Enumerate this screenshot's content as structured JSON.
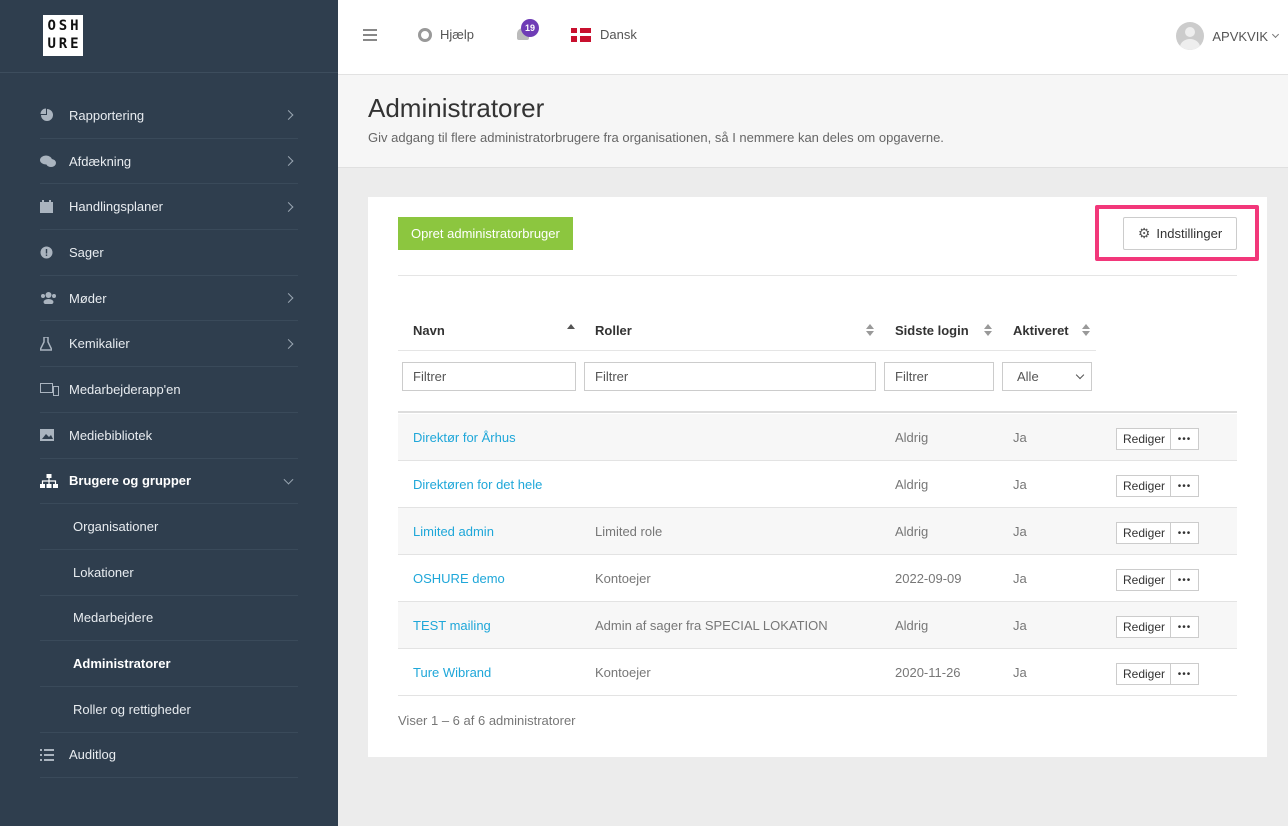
{
  "logo": {
    "letters": [
      "O",
      "S",
      "H",
      "U",
      "R",
      "E"
    ]
  },
  "sidebar": {
    "items": [
      {
        "label": "Rapportering",
        "icon": "pie-chart-icon"
      },
      {
        "label": "Afdækning",
        "icon": "chat-bubbles-icon"
      },
      {
        "label": "Handlingsplaner",
        "icon": "calendar-icon"
      },
      {
        "label": "Sager",
        "icon": "exclamation-circle-icon"
      },
      {
        "label": "Møder",
        "icon": "people-icon"
      },
      {
        "label": "Kemikalier",
        "icon": "flask-icon"
      },
      {
        "label": "Medarbejderapp'en",
        "icon": "devices-icon"
      },
      {
        "label": "Mediebibliotek",
        "icon": "image-icon"
      },
      {
        "label": "Brugere og grupper",
        "icon": "sitemap-icon"
      },
      {
        "label": "Organisationer"
      },
      {
        "label": "Lokationer"
      },
      {
        "label": "Medarbejdere"
      },
      {
        "label": "Administratorer"
      },
      {
        "label": "Roller og rettigheder"
      },
      {
        "label": "Auditlog",
        "icon": "list-icon"
      }
    ]
  },
  "topbar": {
    "help_label": "Hjælp",
    "notification_count": "19",
    "language_label": "Dansk",
    "user_name": "APVKVIK"
  },
  "header": {
    "title": "Administratorer",
    "subtitle": "Giv adgang til flere administratorbrugere fra organisationen, så I nemmere kan deles om opgaverne."
  },
  "toolbar": {
    "create_label": "Opret administratorbruger",
    "settings_label": "Indstillinger"
  },
  "table": {
    "columns": [
      "Navn",
      "Roller",
      "Sidste login",
      "Aktiveret"
    ],
    "filter_placeholder": "Filtrer",
    "active_filter_value": "Alle",
    "edit_label": "Rediger",
    "more_label": "•••",
    "rows": [
      {
        "name": "Direktør for Århus",
        "role": "",
        "last_login": "Aldrig",
        "active": "Ja"
      },
      {
        "name": "Direktøren for det hele",
        "role": "",
        "last_login": "Aldrig",
        "active": "Ja"
      },
      {
        "name": "Limited admin",
        "role": "Limited role",
        "last_login": "Aldrig",
        "active": "Ja"
      },
      {
        "name": "OSHURE demo",
        "role": "Kontoejer",
        "last_login": "2022-09-09",
        "active": "Ja"
      },
      {
        "name": "TEST mailing",
        "role": "Admin af sager fra SPECIAL LOKATION",
        "last_login": "Aldrig",
        "active": "Ja"
      },
      {
        "name": "Ture Wibrand",
        "role": "Kontoejer",
        "last_login": "2020-11-26",
        "active": "Ja"
      }
    ],
    "footer": "Viser 1 – 6 af 6 administratorer"
  },
  "colors": {
    "sidebar": "#2f3e4e",
    "accent_green": "#8cc63f",
    "link": "#1fa7d9",
    "highlight": "#f2377a",
    "badge": "#6f3cb6"
  }
}
